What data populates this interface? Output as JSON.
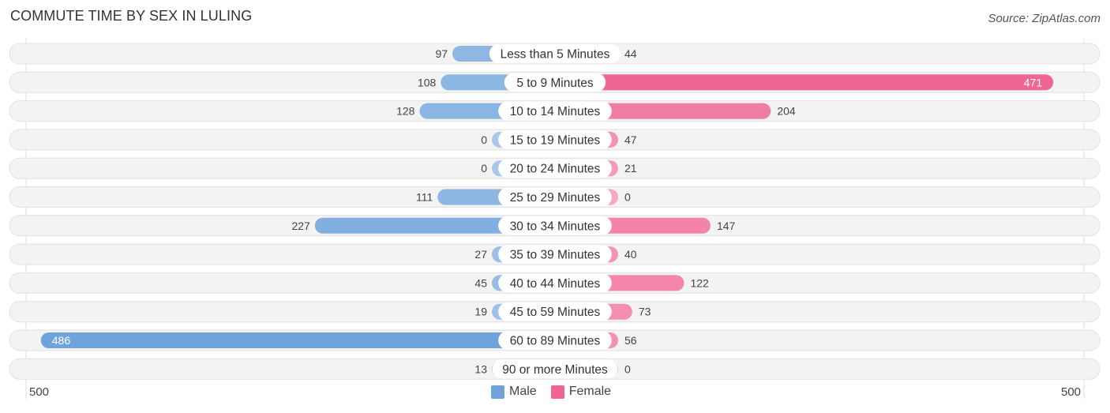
{
  "header": {
    "title": "COMMUTE TIME BY SEX IN LULING",
    "source": "Source: ZipAtlas.com"
  },
  "colors": {
    "male": "#6fa3dc",
    "male_light": "#a8c8ea",
    "female": "#f06592",
    "female_light": "#f7a8c0",
    "row_bg": "#f3f3f3"
  },
  "chart_data": {
    "type": "bar",
    "orientation": "horizontal-diverging",
    "title": "COMMUTE TIME BY SEX IN LULING",
    "categories": [
      "Less than 5 Minutes",
      "5 to 9 Minutes",
      "10 to 14 Minutes",
      "15 to 19 Minutes",
      "20 to 24 Minutes",
      "25 to 29 Minutes",
      "30 to 34 Minutes",
      "35 to 39 Minutes",
      "40 to 44 Minutes",
      "45 to 59 Minutes",
      "60 to 89 Minutes",
      "90 or more Minutes"
    ],
    "series": [
      {
        "name": "Male",
        "values": [
          97,
          108,
          128,
          0,
          0,
          111,
          227,
          27,
          45,
          19,
          486,
          13
        ]
      },
      {
        "name": "Female",
        "values": [
          44,
          471,
          204,
          47,
          21,
          0,
          147,
          40,
          122,
          73,
          56,
          0
        ]
      }
    ],
    "axis": {
      "left_label": "500",
      "right_label": "500",
      "range": [
        0,
        500
      ]
    },
    "legend": {
      "position": "bottom-center",
      "entries": [
        "Male",
        "Female"
      ]
    },
    "grid": false
  }
}
